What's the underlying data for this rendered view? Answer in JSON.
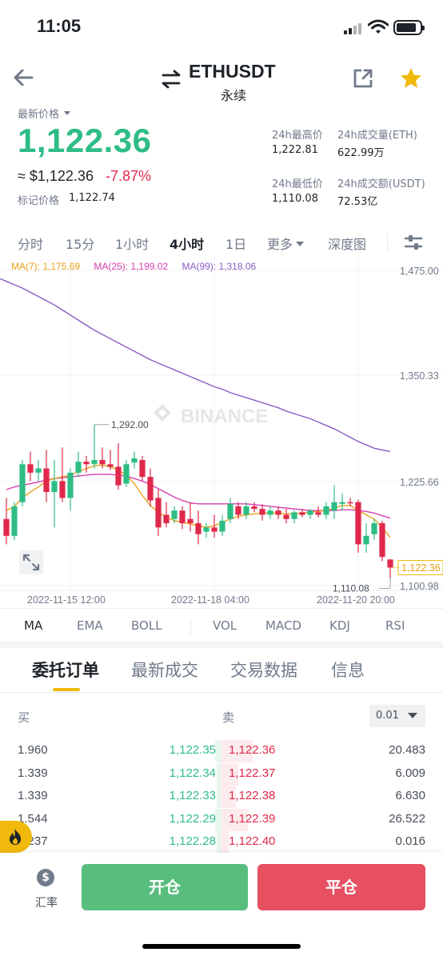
{
  "status_bar": {
    "time": "11:05"
  },
  "header": {
    "symbol": "ETHUSDT",
    "contract_type": "永续"
  },
  "price": {
    "label": "最新价格",
    "last": "1,122.36",
    "approx": "≈ $1,122.36",
    "change_pct": "-7.87%",
    "mark_label": "标记价格",
    "mark_value": "1,122.74"
  },
  "stats": {
    "high_label": "24h最高价",
    "high_value": "1,222.81",
    "vol_eth_label": "24h成交量(ETH)",
    "vol_eth_value": "622.99万",
    "low_label": "24h最低价",
    "low_value": "1,110.08",
    "vol_usdt_label": "24h成交额(USDT)",
    "vol_usdt_value": "72.53亿"
  },
  "intervals": [
    "分时",
    "15分",
    "1小时",
    "4小时",
    "1日",
    "更多",
    "深度图"
  ],
  "active_interval": "4小时",
  "ma_legend": {
    "ma7": "MA(7): 1,175.69",
    "ma25": "MA(25): 1,199.02",
    "ma99": "MA(99): 1,318.06"
  },
  "chart_data": {
    "type": "candlestick",
    "watermark": "BINANCE",
    "y_ticks": [
      "1,475.00",
      "1,350.33",
      "1,225.66",
      "1,100.98"
    ],
    "ylim": [
      1100.98,
      1475.0
    ],
    "x_ticks": [
      "2022-11-15 12:00",
      "2022-11-18 04:00",
      "2022-11-20 20:00"
    ],
    "high_annotation": "1,292.00",
    "low_annotation": "1,110.08",
    "last_price_label": "1,122.36",
    "candles": [
      {
        "o": 1180,
        "h": 1205,
        "l": 1150,
        "c": 1160
      },
      {
        "o": 1160,
        "h": 1200,
        "l": 1155,
        "c": 1195
      },
      {
        "o": 1200,
        "h": 1250,
        "l": 1195,
        "c": 1245
      },
      {
        "o": 1245,
        "h": 1260,
        "l": 1225,
        "c": 1235
      },
      {
        "o": 1235,
        "h": 1250,
        "l": 1225,
        "c": 1240
      },
      {
        "o": 1240,
        "h": 1262,
        "l": 1200,
        "c": 1212
      },
      {
        "o": 1212,
        "h": 1250,
        "l": 1170,
        "c": 1225
      },
      {
        "o": 1225,
        "h": 1265,
        "l": 1200,
        "c": 1205
      },
      {
        "o": 1205,
        "h": 1240,
        "l": 1190,
        "c": 1235
      },
      {
        "o": 1235,
        "h": 1260,
        "l": 1230,
        "c": 1248
      },
      {
        "o": 1248,
        "h": 1255,
        "l": 1235,
        "c": 1245
      },
      {
        "o": 1245,
        "h": 1292,
        "l": 1240,
        "c": 1250
      },
      {
        "o": 1250,
        "h": 1265,
        "l": 1240,
        "c": 1245
      },
      {
        "o": 1245,
        "h": 1262,
        "l": 1238,
        "c": 1242
      },
      {
        "o": 1242,
        "h": 1270,
        "l": 1215,
        "c": 1220
      },
      {
        "o": 1222,
        "h": 1250,
        "l": 1218,
        "c": 1245
      },
      {
        "o": 1247,
        "h": 1260,
        "l": 1240,
        "c": 1252
      },
      {
        "o": 1250,
        "h": 1255,
        "l": 1225,
        "c": 1230
      },
      {
        "o": 1230,
        "h": 1240,
        "l": 1195,
        "c": 1202
      },
      {
        "o": 1205,
        "h": 1215,
        "l": 1160,
        "c": 1170
      },
      {
        "o": 1185,
        "h": 1200,
        "l": 1170,
        "c": 1175
      },
      {
        "o": 1180,
        "h": 1195,
        "l": 1175,
        "c": 1190
      },
      {
        "o": 1190,
        "h": 1195,
        "l": 1168,
        "c": 1175
      },
      {
        "o": 1180,
        "h": 1200,
        "l": 1165,
        "c": 1175
      },
      {
        "o": 1175,
        "h": 1190,
        "l": 1150,
        "c": 1162
      },
      {
        "o": 1165,
        "h": 1175,
        "l": 1158,
        "c": 1170
      },
      {
        "o": 1170,
        "h": 1185,
        "l": 1158,
        "c": 1165
      },
      {
        "o": 1165,
        "h": 1185,
        "l": 1160,
        "c": 1178
      },
      {
        "o": 1180,
        "h": 1205,
        "l": 1175,
        "c": 1198
      },
      {
        "o": 1195,
        "h": 1200,
        "l": 1180,
        "c": 1185
      },
      {
        "o": 1185,
        "h": 1200,
        "l": 1180,
        "c": 1195
      },
      {
        "o": 1195,
        "h": 1200,
        "l": 1188,
        "c": 1192
      },
      {
        "o": 1192,
        "h": 1198,
        "l": 1178,
        "c": 1185
      },
      {
        "o": 1185,
        "h": 1195,
        "l": 1180,
        "c": 1190
      },
      {
        "o": 1190,
        "h": 1195,
        "l": 1180,
        "c": 1185
      },
      {
        "o": 1185,
        "h": 1192,
        "l": 1175,
        "c": 1180
      },
      {
        "o": 1180,
        "h": 1190,
        "l": 1175,
        "c": 1188
      },
      {
        "o": 1188,
        "h": 1192,
        "l": 1182,
        "c": 1185
      },
      {
        "o": 1185,
        "h": 1192,
        "l": 1180,
        "c": 1190
      },
      {
        "o": 1188,
        "h": 1195,
        "l": 1182,
        "c": 1185
      },
      {
        "o": 1185,
        "h": 1200,
        "l": 1180,
        "c": 1195
      },
      {
        "o": 1190,
        "h": 1220,
        "l": 1180,
        "c": 1200
      },
      {
        "o": 1198,
        "h": 1210,
        "l": 1190,
        "c": 1200
      },
      {
        "o": 1200,
        "h": 1205,
        "l": 1195,
        "c": 1199
      },
      {
        "o": 1200,
        "h": 1203,
        "l": 1140,
        "c": 1150
      },
      {
        "o": 1150,
        "h": 1175,
        "l": 1140,
        "c": 1160
      },
      {
        "o": 1162,
        "h": 1180,
        "l": 1155,
        "c": 1175
      },
      {
        "o": 1175,
        "h": 1178,
        "l": 1130,
        "c": 1135
      },
      {
        "o": 1132,
        "h": 1132,
        "l": 1110.08,
        "c": 1122.36
      }
    ],
    "ma7": [
      1190,
      1195,
      1205,
      1212,
      1218,
      1225,
      1228,
      1230,
      1232,
      1236,
      1240,
      1243,
      1244,
      1242,
      1238,
      1232,
      1222,
      1208,
      1196,
      1188,
      1182,
      1178,
      1176,
      1174,
      1172,
      1170,
      1172,
      1176,
      1180,
      1183,
      1185,
      1186,
      1187,
      1187,
      1187,
      1186,
      1186,
      1187,
      1188,
      1189,
      1190,
      1193,
      1196,
      1196,
      1190,
      1185,
      1180,
      1170,
      1158
    ],
    "ma25": [
      1215,
      1218,
      1220,
      1222,
      1224,
      1226,
      1228,
      1229,
      1230,
      1231,
      1232,
      1233,
      1233,
      1233,
      1232,
      1231,
      1228,
      1225,
      1221,
      1216,
      1211,
      1206,
      1202,
      1199,
      1198,
      1198,
      1198,
      1198,
      1198,
      1198,
      1198,
      1197,
      1196,
      1195,
      1194,
      1193,
      1192,
      1191,
      1190,
      1190,
      1190,
      1190,
      1191,
      1191,
      1190,
      1189,
      1187,
      1184,
      1181
    ],
    "ma99": [
      1462,
      1458,
      1454,
      1449,
      1444,
      1439,
      1434,
      1428,
      1422,
      1416,
      1410,
      1404,
      1399,
      1394,
      1389,
      1384,
      1379,
      1374,
      1369,
      1365,
      1361,
      1357,
      1353,
      1349,
      1345,
      1341,
      1337,
      1334,
      1330,
      1327,
      1324,
      1321,
      1318,
      1315,
      1312,
      1308,
      1305,
      1302,
      1299,
      1295,
      1291,
      1287,
      1282,
      1277,
      1272,
      1268,
      1264,
      1262,
      1260
    ]
  },
  "indicators": [
    "MA",
    "EMA",
    "BOLL",
    "VOL",
    "MACD",
    "KDJ",
    "RSI"
  ],
  "active_indicator": "MA",
  "section_tabs": [
    "委托订单",
    "最新成交",
    "交易数据",
    "信息"
  ],
  "active_section": "委托订单",
  "order_book": {
    "buy_label": "买",
    "sell_label": "卖",
    "precision": "0.01",
    "rows": [
      {
        "bid_qty": "1.960",
        "bid_px": "1,122.35",
        "ask_px": "1,122.36",
        "ask_qty": "20.483"
      },
      {
        "bid_qty": "1.339",
        "bid_px": "1,122.34",
        "ask_px": "1,122.37",
        "ask_qty": "6.009"
      },
      {
        "bid_qty": "1.339",
        "bid_px": "1,122.33",
        "ask_px": "1,122.38",
        "ask_qty": "6.630"
      },
      {
        "bid_qty": "1.544",
        "bid_px": "1,122.29",
        "ask_px": "1,122.39",
        "ask_qty": "26.522"
      },
      {
        "bid_qty": "1.237",
        "bid_px": "1,122.28",
        "ask_px": "1,122.40",
        "ask_qty": "0.016"
      }
    ]
  },
  "bottom_bar": {
    "rate_label": "汇率",
    "open_label": "开仓",
    "close_label": "平仓"
  },
  "colors": {
    "up": "#2ebd85",
    "down": "#e0294a",
    "accent": "#f0b90b",
    "ma7": "#e8a317",
    "ma25": "#d63fb0",
    "ma99": "#8a5cc4"
  }
}
